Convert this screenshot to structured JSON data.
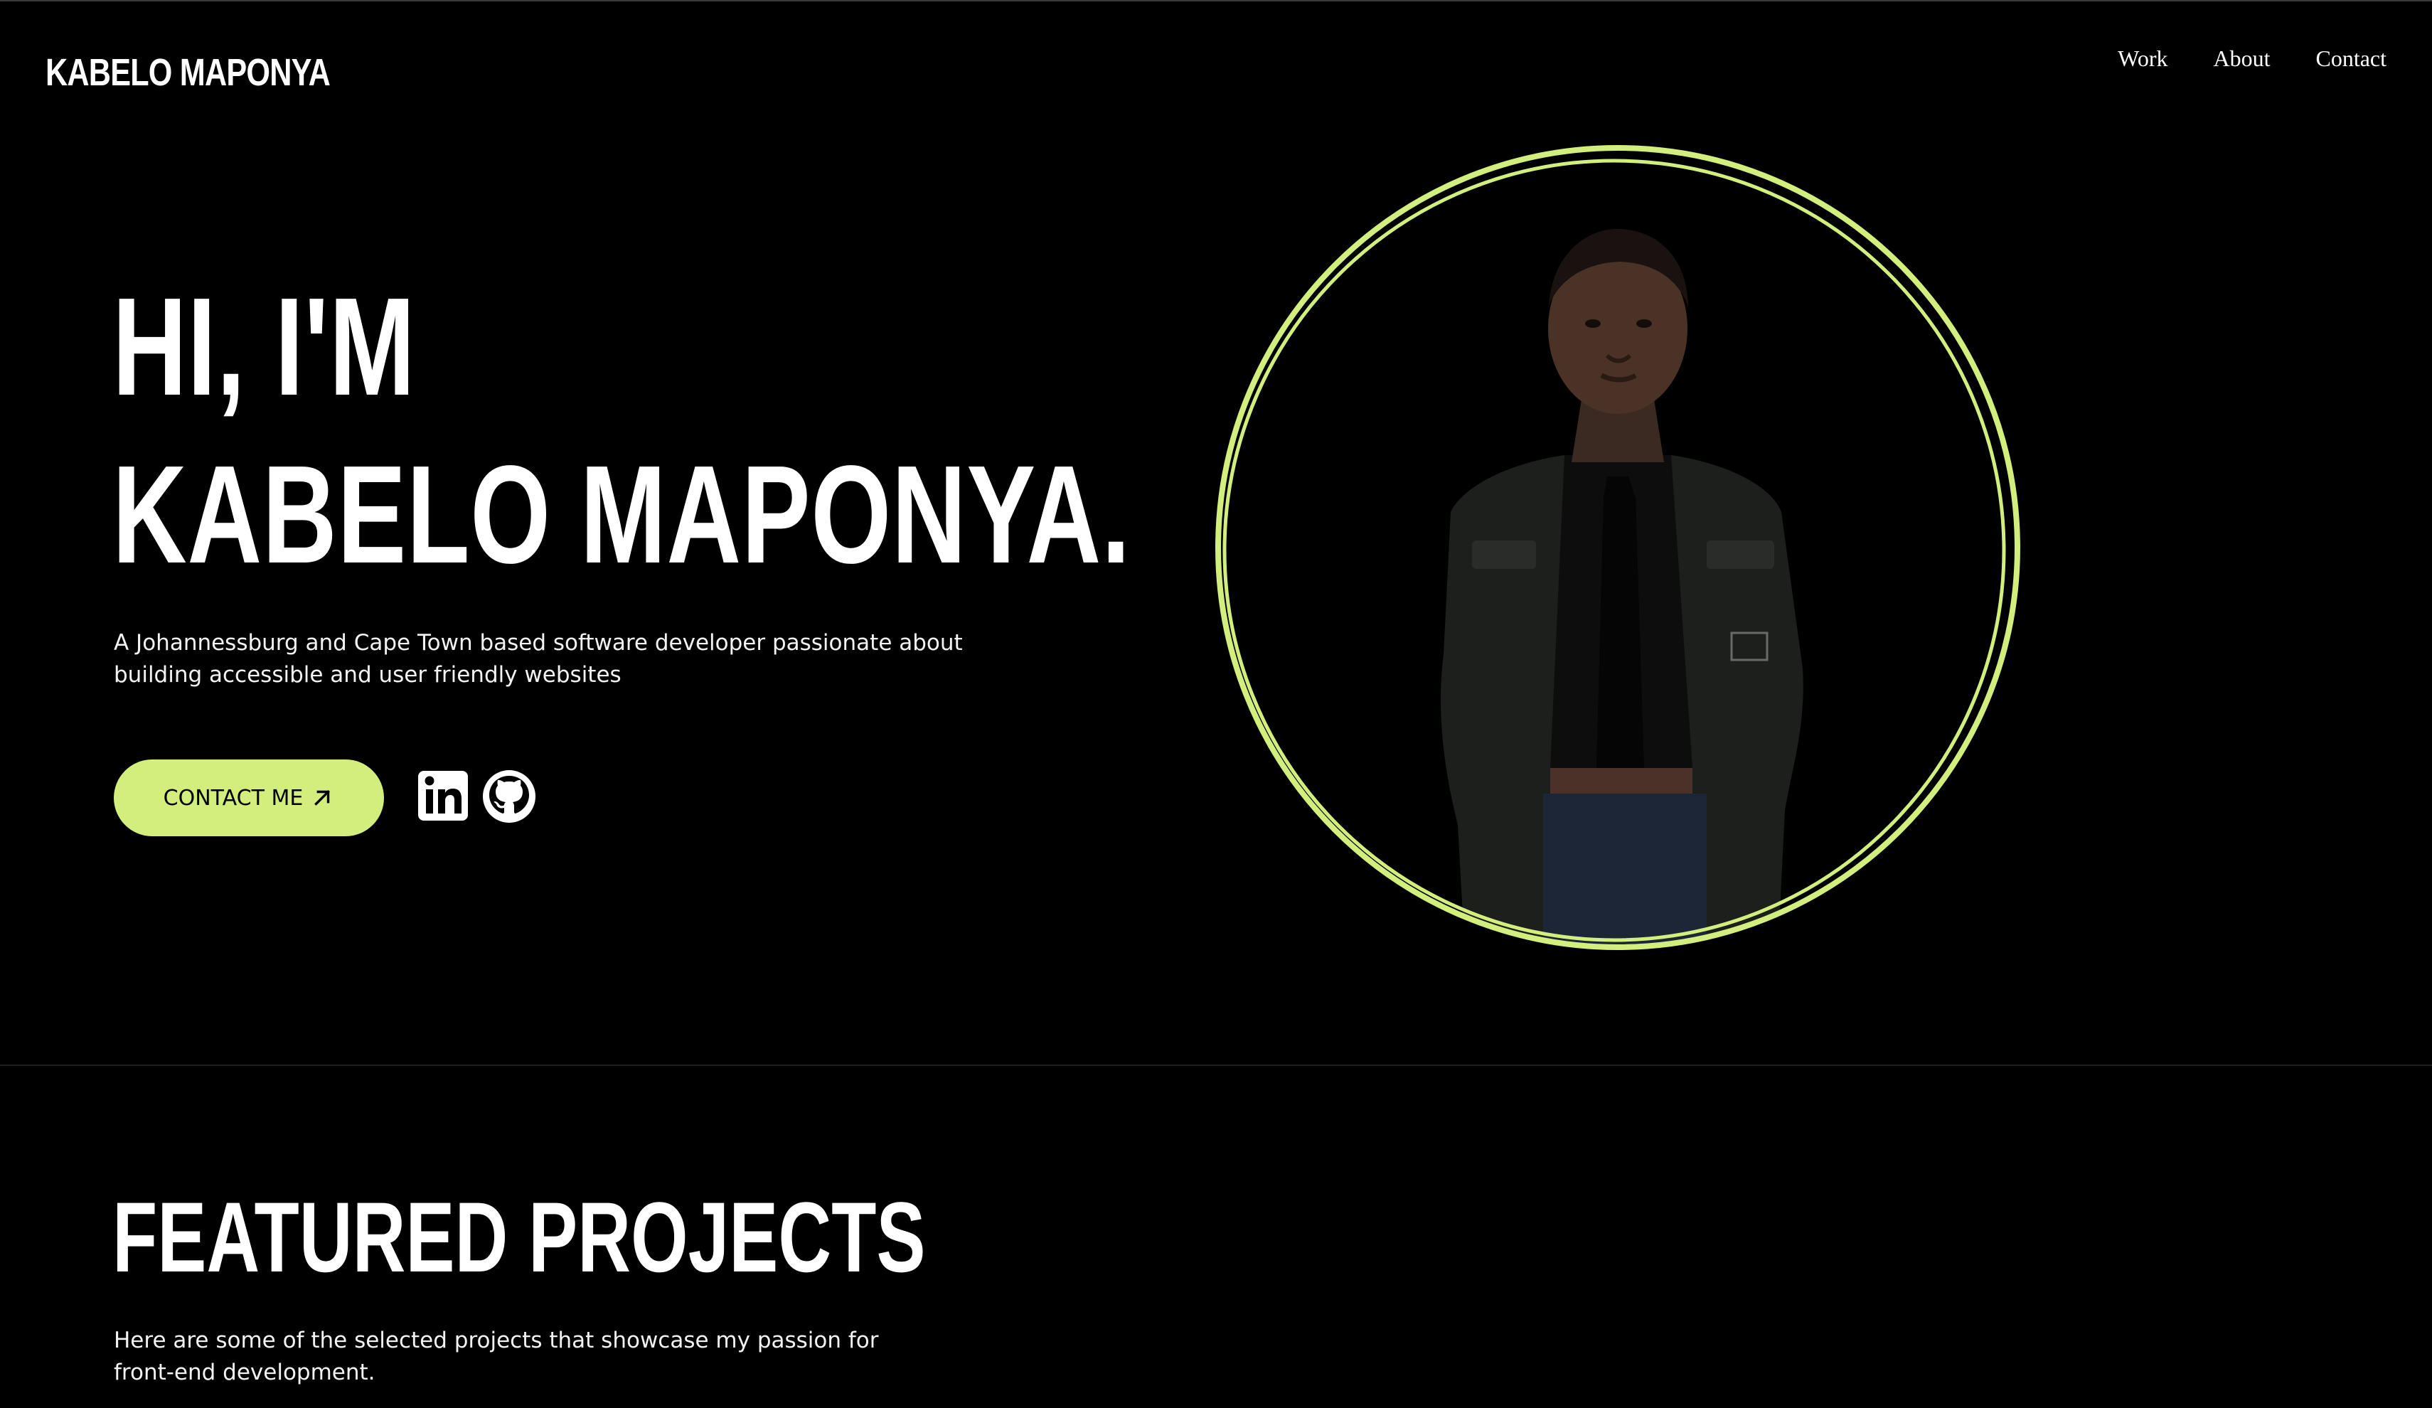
{
  "header": {
    "logo": "KABELO MAPONYA",
    "nav": [
      {
        "label": "Work"
      },
      {
        "label": "About"
      },
      {
        "label": "Contact"
      }
    ]
  },
  "hero": {
    "title_line1": "HI, I'M",
    "title_line2": "KABELO MAPONYA.",
    "description": "A Johannessburg and Cape Town based software developer passionate about building accessible and user friendly websites",
    "cta_label": "CONTACT ME",
    "social": [
      {
        "icon": "linkedin-icon"
      },
      {
        "icon": "github-icon"
      }
    ]
  },
  "projects": {
    "title": "FEATURED PROJECTS",
    "description": "Here are some of the selected projects that showcase my passion for front-end development."
  },
  "colors": {
    "background": "#000000",
    "accent": "#d2ee7d",
    "text": "#ffffff"
  }
}
